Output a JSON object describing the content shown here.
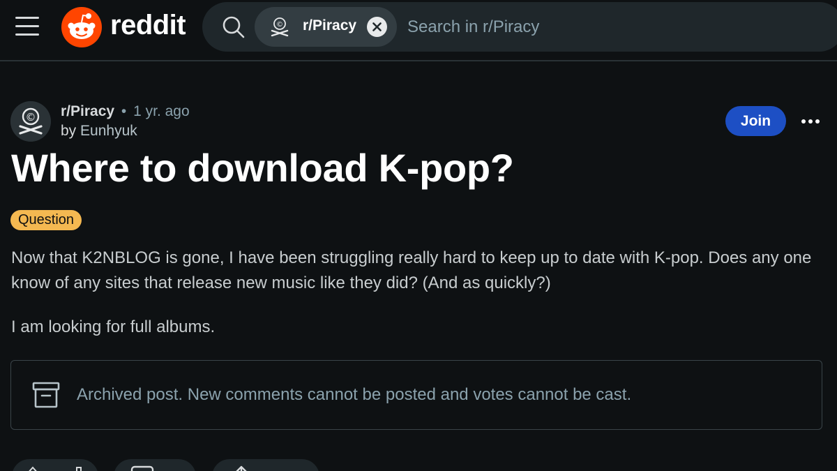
{
  "header": {
    "logo_text": "reddit",
    "subreddit_chip": "r/Piracy",
    "search_placeholder": "Search in r/Piracy"
  },
  "post": {
    "subreddit": "r/Piracy",
    "separator": "•",
    "time_ago": "1 yr. ago",
    "by_label": "by",
    "author": "Eunhyuk",
    "join_label": "Join",
    "title": "Where to download K-pop?",
    "flair": "Question",
    "flair_color": "#f4b851",
    "body": [
      "Now that K2NBLOG is gone, I have been struggling really hard to keep up to date with K-pop. Does any one know of any sites that release new music like they did? (And as quickly?)",
      "I am looking for full albums."
    ],
    "archived_notice": "Archived post. New comments cannot be posted and votes cannot be cast."
  },
  "colors": {
    "background": "#0e1113",
    "brand": "#ff4500",
    "join_button": "#1d4fc4",
    "muted_text": "#8ba2ad"
  },
  "icons": {
    "menu": "hamburger-icon",
    "logo": "reddit-snoo-icon",
    "search": "search-icon",
    "subreddit": "skull-crossbones-icon",
    "clear": "close-icon",
    "more": "ellipsis-icon",
    "archive": "archive-box-icon",
    "upvote": "upvote-icon",
    "downvote": "downvote-icon",
    "comment": "comment-icon",
    "share": "share-icon"
  }
}
